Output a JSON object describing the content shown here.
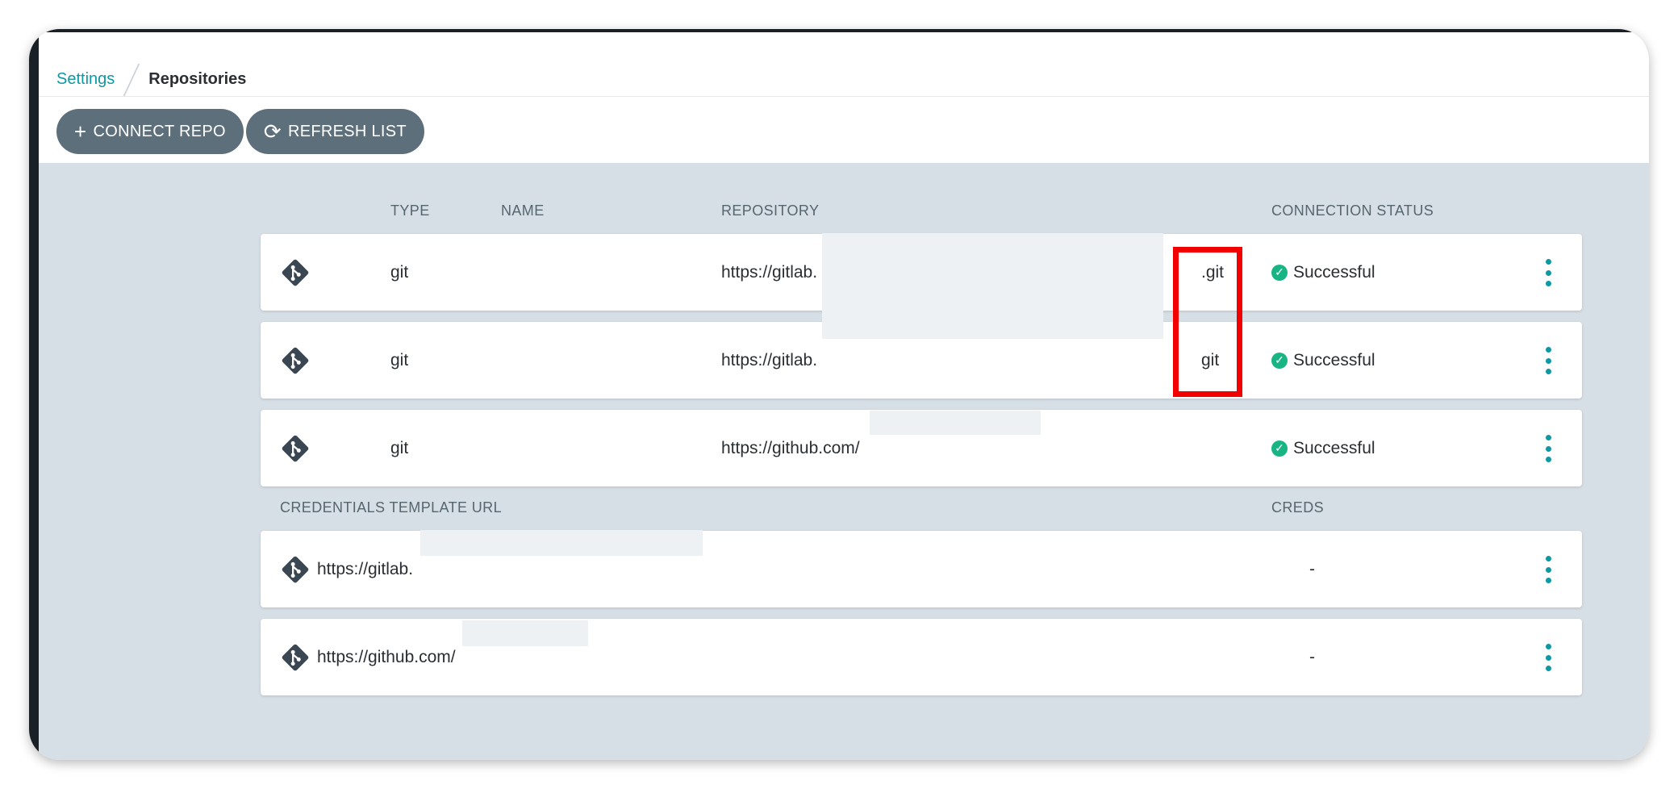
{
  "breadcrumb": {
    "parent": "Settings",
    "current": "Repositories"
  },
  "toolbar": {
    "connect_label": "CONNECT REPO",
    "refresh_label": "REFRESH LIST"
  },
  "repo_table": {
    "headers": {
      "type": "TYPE",
      "name": "NAME",
      "repository": "REPOSITORY",
      "status": "CONNECTION STATUS"
    },
    "rows": [
      {
        "type": "git",
        "name": "",
        "url_start": "https://gitlab.",
        "url_end": ".git",
        "status": "Successful"
      },
      {
        "type": "git",
        "name": "",
        "url_start": "https://gitlab.",
        "url_end": "git",
        "status": "Successful"
      },
      {
        "type": "git",
        "name": "",
        "url_start": "https://github.com/",
        "url_end": "",
        "status": "Successful"
      }
    ]
  },
  "cred_table": {
    "headers": {
      "url": "CREDENTIALS TEMPLATE URL",
      "creds": "CREDS"
    },
    "rows": [
      {
        "url": "https://gitlab.",
        "creds": "-"
      },
      {
        "url": "https://github.com/",
        "creds": "-"
      }
    ]
  },
  "colors": {
    "accent": "#0d99a3",
    "button": "#5e6f7c",
    "success": "#19b484",
    "annotation": "#f20000"
  }
}
